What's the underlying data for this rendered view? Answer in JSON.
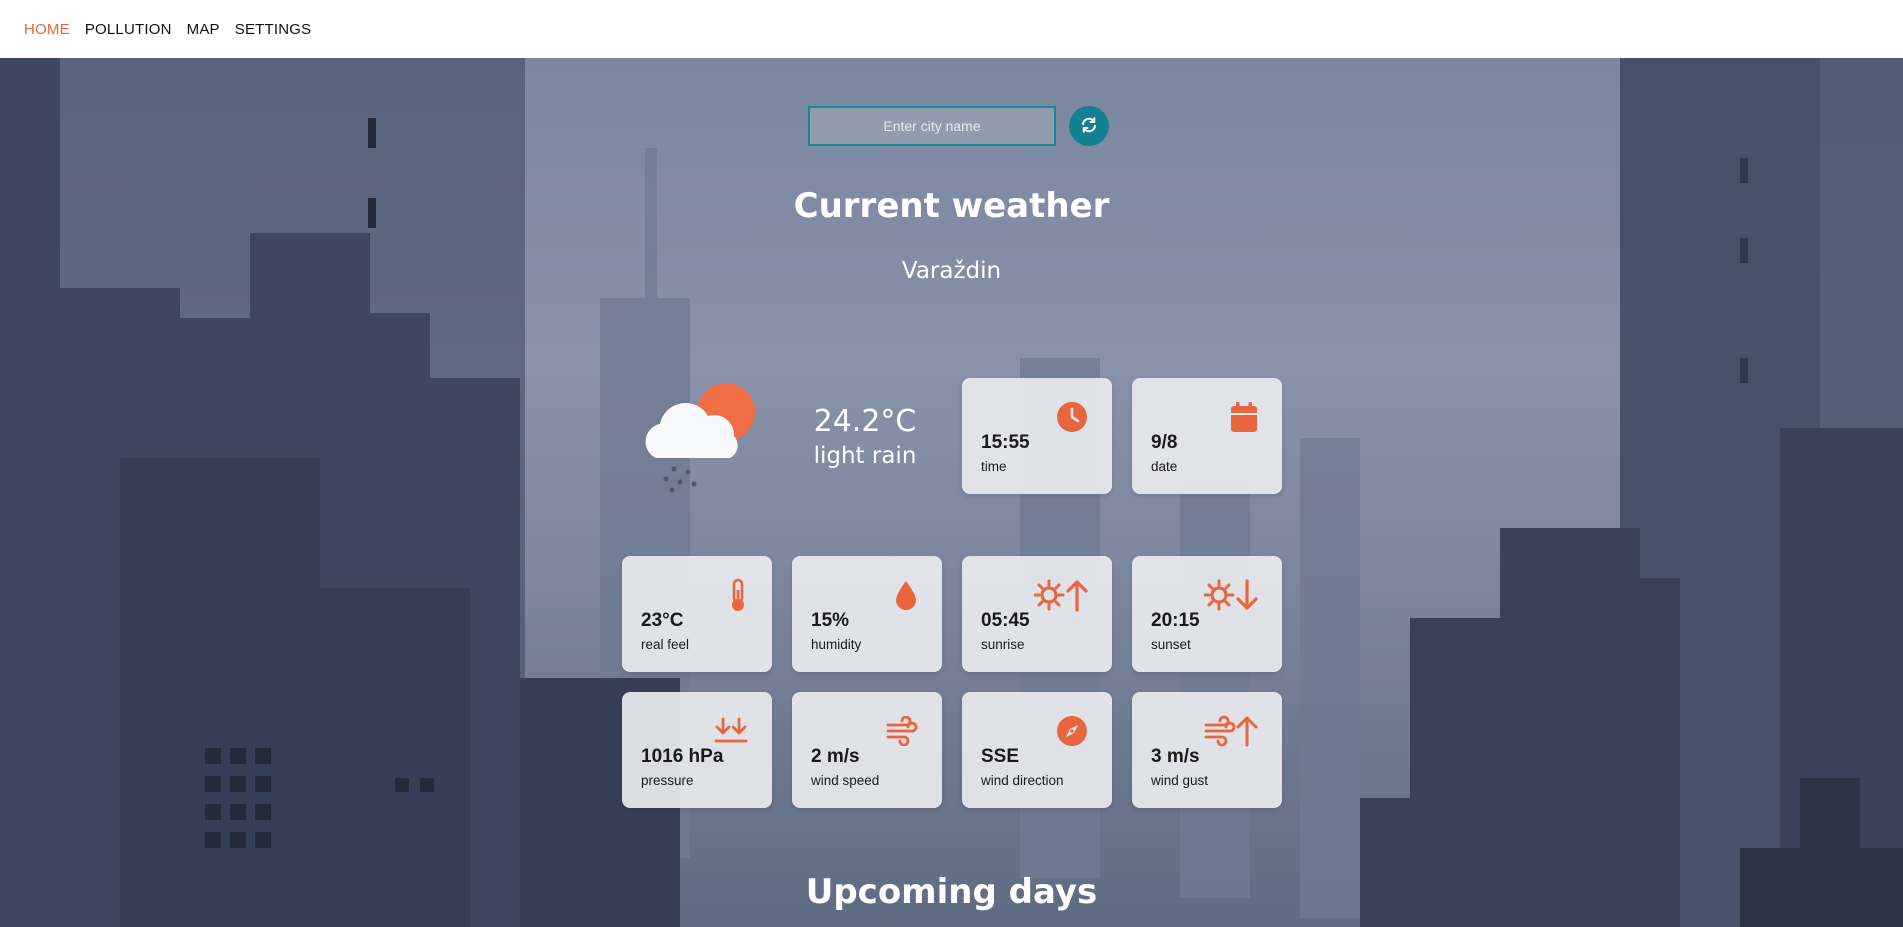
{
  "nav": {
    "items": [
      {
        "label": "HOME",
        "active": true
      },
      {
        "label": "POLLUTION",
        "active": false
      },
      {
        "label": "MAP",
        "active": false
      },
      {
        "label": "SETTINGS",
        "active": false
      }
    ]
  },
  "search": {
    "placeholder": "Enter city name",
    "value": "",
    "refresh_icon": "refresh-icon"
  },
  "current": {
    "title": "Current weather",
    "city": "Varaždin",
    "icon": "cloud-sun-rain-icon",
    "temperature": "24.2°C",
    "description": "light rain"
  },
  "cards": {
    "time": {
      "value": "15:55",
      "label": "time",
      "icon": "clock-icon"
    },
    "date": {
      "value": "9/8",
      "label": "date",
      "icon": "calendar-icon"
    },
    "real_feel": {
      "value": "23°C",
      "label": "real feel",
      "icon": "thermometer-icon"
    },
    "humidity": {
      "value": "15%",
      "label": "humidity",
      "icon": "droplet-icon"
    },
    "sunrise": {
      "value": "05:45",
      "label": "sunrise",
      "icon": "sunrise-icon"
    },
    "sunset": {
      "value": "20:15",
      "label": "sunset",
      "icon": "sunset-icon"
    },
    "pressure": {
      "value": "1016 hPa",
      "label": "pressure",
      "icon": "pressure-icon"
    },
    "wind_speed": {
      "value": "2 m/s",
      "label": "wind speed",
      "icon": "wind-icon"
    },
    "wind_direction": {
      "value": "SSE",
      "label": "wind direction",
      "icon": "compass-icon"
    },
    "wind_gust": {
      "value": "3 m/s",
      "label": "wind gust",
      "icon": "wind-gust-icon"
    }
  },
  "upcoming": {
    "title": "Upcoming days"
  },
  "colors": {
    "accent": "#e8663d",
    "teal": "#13818f",
    "card_bg": "#e8eaee"
  }
}
